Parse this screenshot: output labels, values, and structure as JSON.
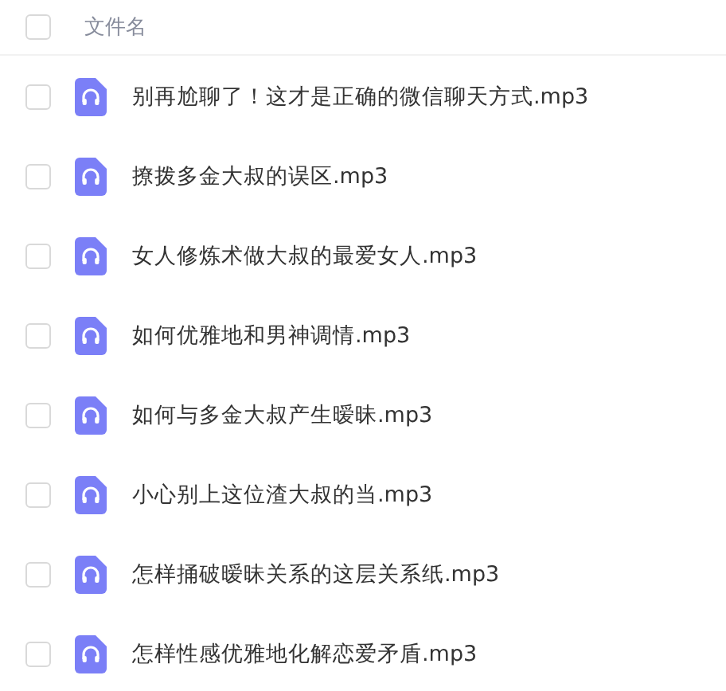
{
  "header": {
    "checked": false,
    "label": "文件名"
  },
  "files": [
    {
      "name": "别再尬聊了！这才是正确的微信聊天方式.mp3",
      "checked": false
    },
    {
      "name": "撩拨多金大叔的误区.mp3",
      "checked": false
    },
    {
      "name": "女人修炼术做大叔的最爱女人.mp3",
      "checked": false
    },
    {
      "name": "如何优雅地和男神调情.mp3",
      "checked": false
    },
    {
      "name": "如何与多金大叔产生暧昧.mp3",
      "checked": false
    },
    {
      "name": "小心别上这位渣大叔的当.mp3",
      "checked": false
    },
    {
      "name": "怎样捅破暧昧关系的这层关系纸.mp3",
      "checked": false
    },
    {
      "name": "怎样性感优雅地化解恋爱矛盾.mp3",
      "checked": false
    }
  ]
}
